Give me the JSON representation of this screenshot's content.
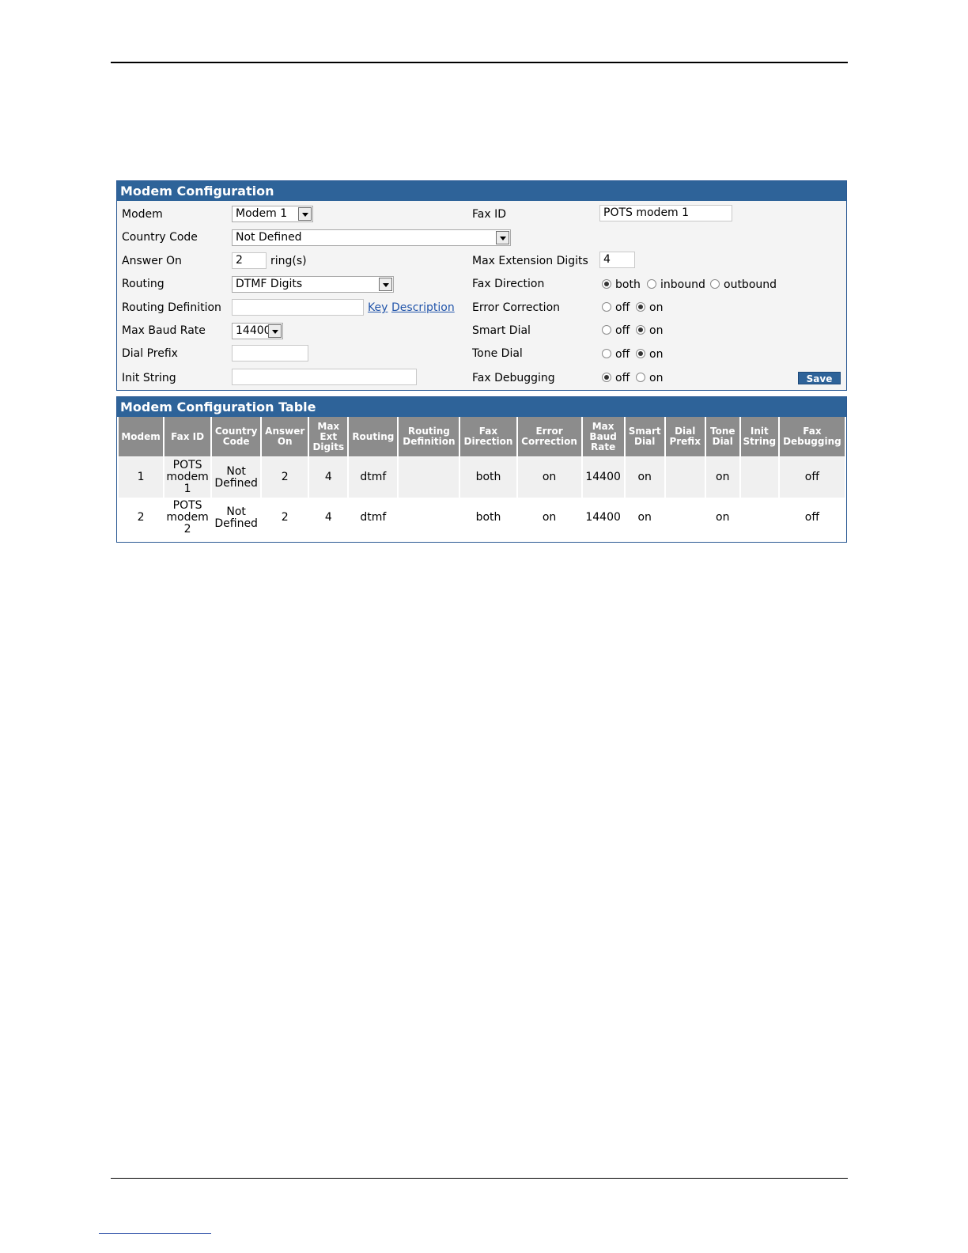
{
  "config": {
    "title": "Modem Configuration",
    "labels": {
      "modem": "Modem",
      "country_code": "Country Code",
      "answer_on": "Answer On",
      "routing": "Routing",
      "routing_definition": "Routing Definition",
      "max_baud_rate": "Max Baud Rate",
      "dial_prefix": "Dial Prefix",
      "init_string": "Init String",
      "fax_id": "Fax ID",
      "max_extension_digits": "Max Extension Digits",
      "fax_direction": "Fax Direction",
      "error_correction": "Error Correction",
      "smart_dial": "Smart Dial",
      "tone_dial": "Tone Dial",
      "fax_debugging": "Fax Debugging"
    },
    "values": {
      "modem": "Modem 1",
      "country_code": "Not Defined",
      "answer_on": "2",
      "answer_on_suffix": "ring(s)",
      "routing": "DTMF Digits",
      "routing_definition": "",
      "max_baud_rate": "14400",
      "dial_prefix": "",
      "init_string": "",
      "fax_id": "POTS modem 1",
      "max_extension_digits": "4"
    },
    "links": {
      "key": "Key",
      "description": "Description"
    },
    "radio": {
      "both": "both",
      "inbound": "inbound",
      "outbound": "outbound",
      "off": "off",
      "on": "on"
    },
    "selected": {
      "fax_direction": "both",
      "error_correction": "on",
      "smart_dial": "on",
      "tone_dial": "on",
      "fax_debugging": "off"
    },
    "save_label": "Save"
  },
  "table": {
    "title": "Modem Configuration Table",
    "headers": [
      [
        "Modem"
      ],
      [
        "Fax ID"
      ],
      [
        "Country",
        "Code"
      ],
      [
        "Answer",
        "On"
      ],
      [
        "Max",
        "Ext",
        "Digits"
      ],
      [
        "Routing"
      ],
      [
        "Routing",
        "Definition"
      ],
      [
        "Fax",
        "Direction"
      ],
      [
        "Error",
        "Correction"
      ],
      [
        "Max",
        "Baud",
        "Rate"
      ],
      [
        "Smart",
        "Dial"
      ],
      [
        "Dial",
        "Prefix"
      ],
      [
        "Tone",
        "Dial"
      ],
      [
        "Init",
        "String"
      ],
      [
        "Fax",
        "Debugging"
      ]
    ],
    "rows": [
      [
        [
          "1"
        ],
        [
          "POTS",
          "modem",
          "1"
        ],
        [
          "Not",
          "Defined"
        ],
        [
          "2"
        ],
        [
          "4"
        ],
        [
          "dtmf"
        ],
        [
          ""
        ],
        [
          "both"
        ],
        [
          "on"
        ],
        [
          "14400"
        ],
        [
          "on"
        ],
        [
          ""
        ],
        [
          "on"
        ],
        [
          ""
        ],
        [
          "off"
        ]
      ],
      [
        [
          "2"
        ],
        [
          "POTS",
          "modem",
          "2"
        ],
        [
          "Not",
          "Defined"
        ],
        [
          "2"
        ],
        [
          "4"
        ],
        [
          "dtmf"
        ],
        [
          ""
        ],
        [
          "both"
        ],
        [
          "on"
        ],
        [
          "14400"
        ],
        [
          "on"
        ],
        [
          ""
        ],
        [
          "on"
        ],
        [
          ""
        ],
        [
          "off"
        ]
      ]
    ]
  }
}
